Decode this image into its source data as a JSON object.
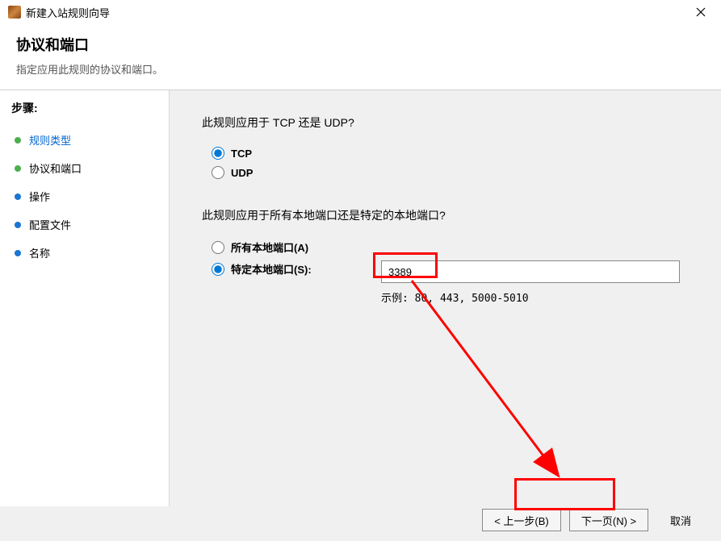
{
  "window": {
    "title": "新建入站规则向导"
  },
  "header": {
    "title": "协议和端口",
    "subtitle": "指定应用此规则的协议和端口。"
  },
  "sidebar": {
    "steps_label": "步骤:",
    "items": [
      {
        "label": "规则类型",
        "current": true,
        "bullet": "active"
      },
      {
        "label": "协议和端口",
        "current": false,
        "bullet": "active"
      },
      {
        "label": "操作",
        "current": false,
        "bullet": "inactive"
      },
      {
        "label": "配置文件",
        "current": false,
        "bullet": "inactive"
      },
      {
        "label": "名称",
        "current": false,
        "bullet": "inactive"
      }
    ]
  },
  "main": {
    "protocol_question": "此规则应用于 TCP 还是 UDP?",
    "protocol_options": {
      "tcp": "TCP",
      "udp": "UDP"
    },
    "port_question": "此规则应用于所有本地端口还是特定的本地端口?",
    "port_options": {
      "all": "所有本地端口(A)",
      "specific": "特定本地端口(S):"
    },
    "port_value": "3389",
    "port_example": "示例: 80, 443, 5000-5010"
  },
  "buttons": {
    "back": "< 上一步(B)",
    "next": "下一页(N) >",
    "cancel": "取消"
  }
}
